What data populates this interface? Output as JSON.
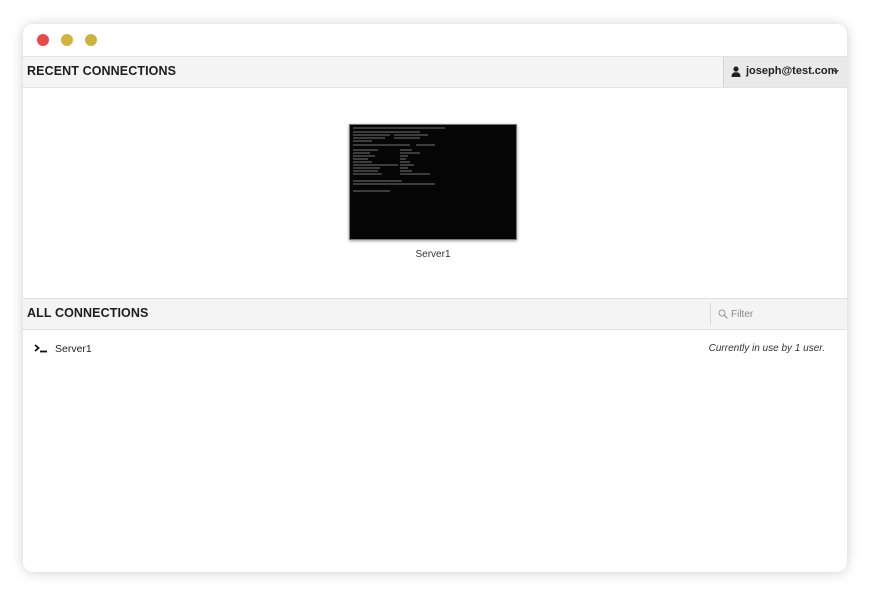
{
  "window": {
    "controls": [
      "close",
      "minimize",
      "maximize"
    ]
  },
  "recent": {
    "title": "RECENT CONNECTIONS",
    "user": {
      "icon": "user-icon",
      "label": "joseph@test.com",
      "menu_icon": "caret-down-icon"
    },
    "thumbnails": [
      {
        "label": "Server1"
      }
    ]
  },
  "all": {
    "title": "ALL CONNECTIONS",
    "filter": {
      "placeholder": "Filter",
      "icon": "search-icon"
    },
    "connections": [
      {
        "name": "Server1",
        "icon": "terminal-icon",
        "status": "Currently in use by 1 user."
      }
    ]
  },
  "colors": {
    "close": "#e9494a",
    "minimize": "#d1b43a",
    "maximize": "#c9b43e",
    "header_bg": "#f4f4f4"
  }
}
